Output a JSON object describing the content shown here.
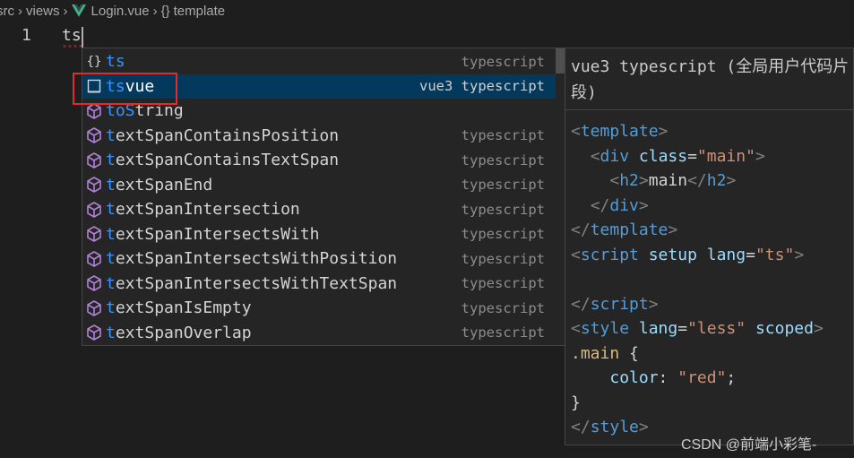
{
  "breadcrumb": {
    "segments": [
      "src",
      "views",
      "Login.vue",
      "template"
    ],
    "braces_glyph": "{}"
  },
  "editor": {
    "line_number": "1",
    "typed_text": "ts"
  },
  "suggestions": [
    {
      "icon": "braces-icon",
      "match": "ts",
      "rest": "",
      "detail": "typescript",
      "selected": false
    },
    {
      "icon": "snippet-icon",
      "match": "ts",
      "rest": "vue",
      "detail": "vue3 typescript",
      "selected": true
    },
    {
      "icon": "method-cube-icon",
      "match": "toS",
      "rest": "tring",
      "detail": "",
      "selected": false
    },
    {
      "icon": "method-cube-icon",
      "match": "t",
      "rest": "extSpanContainsPosition",
      "detail": "typescript",
      "selected": false
    },
    {
      "icon": "method-cube-icon",
      "match": "t",
      "rest": "extSpanContainsTextSpan",
      "detail": "typescript",
      "selected": false
    },
    {
      "icon": "method-cube-icon",
      "match": "t",
      "rest": "extSpanEnd",
      "detail": "typescript",
      "selected": false
    },
    {
      "icon": "method-cube-icon",
      "match": "t",
      "rest": "extSpanIntersection",
      "detail": "typescript",
      "selected": false
    },
    {
      "icon": "method-cube-icon",
      "match": "t",
      "rest": "extSpanIntersectsWith",
      "detail": "typescript",
      "selected": false
    },
    {
      "icon": "method-cube-icon",
      "match": "t",
      "rest": "extSpanIntersectsWithPosition",
      "detail": "typescript",
      "selected": false
    },
    {
      "icon": "method-cube-icon",
      "match": "t",
      "rest": "extSpanIntersectsWithTextSpan",
      "detail": "typescript",
      "selected": false
    },
    {
      "icon": "method-cube-icon",
      "match": "t",
      "rest": "extSpanIsEmpty",
      "detail": "typescript",
      "selected": false
    },
    {
      "icon": "method-cube-icon",
      "match": "t",
      "rest": "extSpanOverlap",
      "detail": "typescript",
      "selected": false
    }
  ],
  "doc": {
    "title_line1": "vue3 typescript (全局用户代码片",
    "title_line2": "段)",
    "code": [
      [
        [
          "bracket",
          "<"
        ],
        [
          "tag",
          "template"
        ],
        [
          "bracket",
          ">"
        ]
      ],
      [
        [
          "plain",
          "  "
        ],
        [
          "bracket",
          "<"
        ],
        [
          "tag",
          "div"
        ],
        [
          "plain",
          " "
        ],
        [
          "attr",
          "class"
        ],
        [
          "plain",
          "="
        ],
        [
          "str",
          "\"main\""
        ],
        [
          "bracket",
          ">"
        ]
      ],
      [
        [
          "plain",
          "    "
        ],
        [
          "bracket",
          "<"
        ],
        [
          "tag",
          "h2"
        ],
        [
          "bracket",
          ">"
        ],
        [
          "plain",
          "main"
        ],
        [
          "bracket",
          "</"
        ],
        [
          "tag",
          "h2"
        ],
        [
          "bracket",
          ">"
        ]
      ],
      [
        [
          "plain",
          "  "
        ],
        [
          "bracket",
          "</"
        ],
        [
          "tag",
          "div"
        ],
        [
          "bracket",
          ">"
        ]
      ],
      [
        [
          "bracket",
          "</"
        ],
        [
          "tag",
          "template"
        ],
        [
          "bracket",
          ">"
        ]
      ],
      [
        [
          "bracket",
          "<"
        ],
        [
          "tag",
          "script"
        ],
        [
          "plain",
          " "
        ],
        [
          "attr",
          "setup"
        ],
        [
          "plain",
          " "
        ],
        [
          "attr",
          "lang"
        ],
        [
          "plain",
          "="
        ],
        [
          "str",
          "\"ts\""
        ],
        [
          "bracket",
          ">"
        ]
      ],
      [
        [
          "plain",
          ""
        ]
      ],
      [
        [
          "bracket",
          "</"
        ],
        [
          "tag",
          "script"
        ],
        [
          "bracket",
          ">"
        ]
      ],
      [
        [
          "bracket",
          "<"
        ],
        [
          "tag",
          "style"
        ],
        [
          "plain",
          " "
        ],
        [
          "attr",
          "lang"
        ],
        [
          "plain",
          "="
        ],
        [
          "str",
          "\"less\""
        ],
        [
          "plain",
          " "
        ],
        [
          "attr",
          "scoped"
        ],
        [
          "bracket",
          ">"
        ]
      ],
      [
        [
          "sel",
          ".main"
        ],
        [
          "plain",
          " {"
        ]
      ],
      [
        [
          "plain",
          "    "
        ],
        [
          "attr",
          "color"
        ],
        [
          "plain",
          ": "
        ],
        [
          "str",
          "\"red\""
        ],
        [
          "plain",
          ";"
        ]
      ],
      [
        [
          "plain",
          "}"
        ]
      ],
      [
        [
          "bracket",
          "</"
        ],
        [
          "tag",
          "style"
        ],
        [
          "bracket",
          ">"
        ]
      ]
    ]
  },
  "watermark": "CSDN @前端小彩笔-",
  "colors": {
    "background": "#1e1e1e",
    "widget_bg": "#252526",
    "selection": "#04395e",
    "match_highlight": "#3794ff",
    "cube_icon": "#b180d7",
    "annotation_box": "#e32b2b"
  }
}
